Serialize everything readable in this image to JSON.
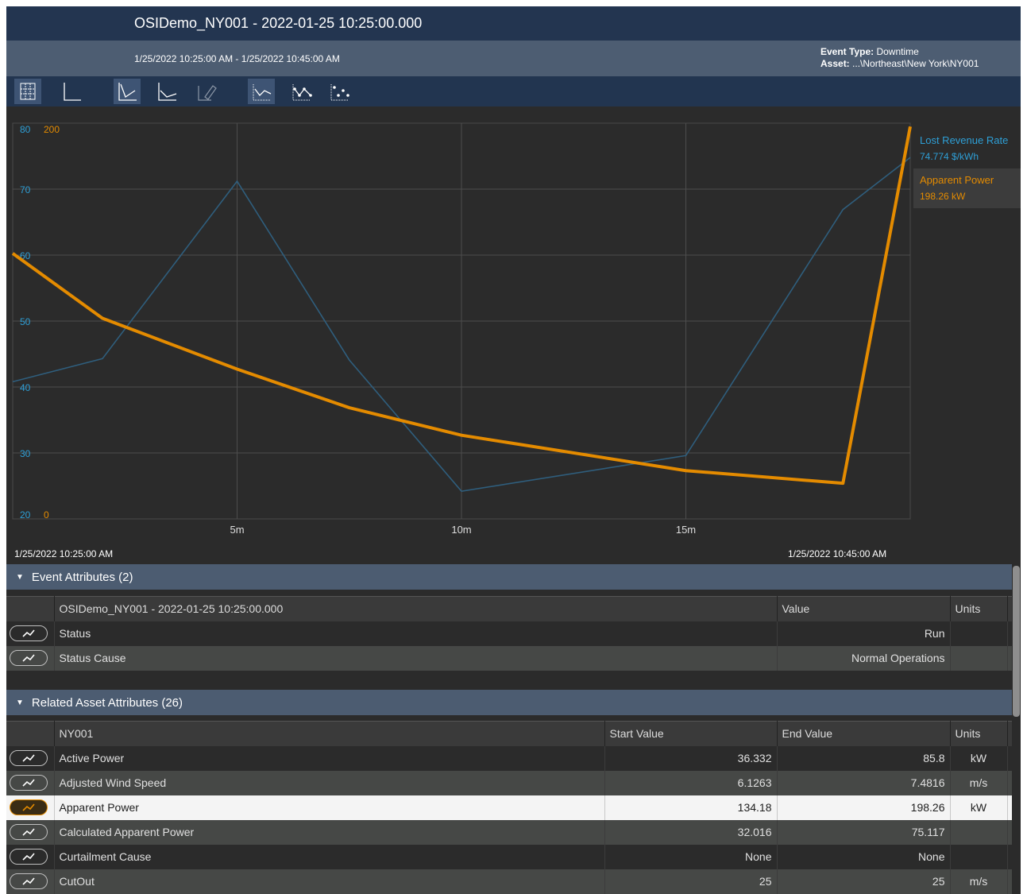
{
  "window": {
    "title": "OSIDemo_NY001 - 2022-01-25 10:25:00.000"
  },
  "info": {
    "time_range": "1/25/2022 10:25:00 AM  -  1/25/2022 10:45:00 AM",
    "event_type_label": "Event Type:",
    "event_type_value": "Downtime",
    "asset_label": "Asset:",
    "asset_value": "...\\Northeast\\New York\\NY001"
  },
  "toolbar": {
    "buttons": [
      {
        "icon": "gridlines-icon",
        "active": true
      },
      {
        "icon": "axes-icon",
        "active": false
      },
      {
        "icon": "trend-line-icon",
        "active": true
      },
      {
        "icon": "trend-step-icon",
        "active": false
      },
      {
        "icon": "trend-pen-icon",
        "active": false,
        "disabled": true
      },
      {
        "icon": "line-only-icon",
        "active": true
      },
      {
        "icon": "line-markers-icon",
        "active": false
      },
      {
        "icon": "markers-only-icon",
        "active": false
      }
    ]
  },
  "chart_data": {
    "type": "line",
    "x_unit": "minutes",
    "xlim": [
      0,
      20
    ],
    "x_ticks": [
      {
        "value": 5,
        "label": "5m"
      },
      {
        "value": 10,
        "label": "10m"
      },
      {
        "value": 15,
        "label": "15m"
      }
    ],
    "start_label": "1/25/2022 10:25:00 AM",
    "end_label": "1/25/2022 10:45:00 AM",
    "grid": true,
    "legend_position": "right",
    "series": [
      {
        "name": "Lost Revenue Rate",
        "current_value": "74.774 $/kWh",
        "color": "#2e9fd6",
        "axis": "left",
        "ylim": [
          20,
          80
        ],
        "y_ticks": [
          20,
          30,
          40,
          50,
          60,
          70,
          80
        ],
        "x": [
          0,
          2,
          5,
          7.5,
          10,
          15,
          18.5,
          20
        ],
        "values": [
          40.8,
          44.3,
          71.2,
          44.1,
          24.2,
          29.6,
          66.9,
          74.8
        ]
      },
      {
        "name": "Apparent Power",
        "current_value": "198.26 kW",
        "color": "#e48b00",
        "axis": "left2",
        "ylim": [
          0,
          200
        ],
        "y_ticks": [
          0,
          200
        ],
        "x": [
          0,
          2,
          5,
          7.5,
          10,
          15,
          18.5,
          20
        ],
        "values": [
          134.2,
          101.4,
          75.7,
          56.2,
          42.3,
          24.4,
          18.0,
          198.3
        ]
      }
    ]
  },
  "event_attributes": {
    "header": "Event Attributes (2)",
    "columns": [
      "OSIDemo_NY001 - 2022-01-25 10:25:00.000",
      "Value",
      "Units"
    ],
    "rows": [
      {
        "name": "Status",
        "value": "Run",
        "units": ""
      },
      {
        "name": "Status Cause",
        "value": "Normal Operations",
        "units": ""
      }
    ]
  },
  "related_attributes": {
    "header": "Related Asset Attributes (26)",
    "columns": [
      "NY001",
      "Start Value",
      "End Value",
      "Units"
    ],
    "rows": [
      {
        "name": "Active Power",
        "start": "36.332",
        "end": "85.8",
        "units": "kW"
      },
      {
        "name": "Adjusted Wind Speed",
        "start": "6.1263",
        "end": "7.4816",
        "units": "m/s"
      },
      {
        "name": "Apparent Power",
        "start": "134.18",
        "end": "198.26",
        "units": "kW",
        "selected": true
      },
      {
        "name": "Calculated Apparent Power",
        "start": "32.016",
        "end": "75.117",
        "units": ""
      },
      {
        "name": "Curtailment Cause",
        "start": "None",
        "end": "None",
        "units": ""
      },
      {
        "name": "CutOut",
        "start": "25",
        "end": "25",
        "units": "m/s"
      }
    ]
  }
}
